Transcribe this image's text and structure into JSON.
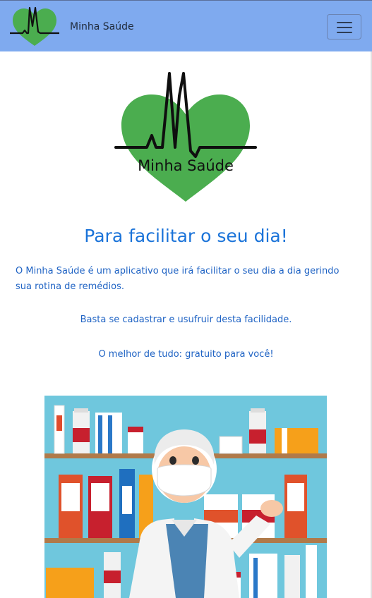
{
  "navbar": {
    "brand": "Minha Saúde",
    "logo_icon": "heart-pulse-logo",
    "toggler_icon": "hamburger-menu-icon",
    "background_color": "#7faaef"
  },
  "hero": {
    "logo_text": "Minha Saúde",
    "logo_color": "#4bad4f"
  },
  "content": {
    "title": "Para facilitar o seu dia!",
    "paragraph_1": "O Minha Saúde é um aplicativo que irá facilitar o seu dia a dia gerindo sua rotina de remédios.",
    "paragraph_2": "Basta se cadastrar e usufruir desta facilidade.",
    "paragraph_3": "O melhor de tudo: gratuito para você!",
    "text_color": "#1f63c4",
    "title_color": "#1a73d9"
  },
  "illustration": {
    "subject": "pharmacist-illustration"
  }
}
